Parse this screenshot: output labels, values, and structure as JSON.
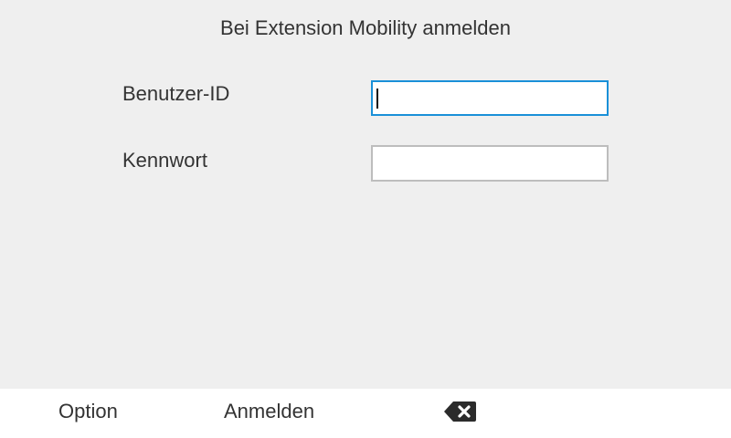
{
  "header": {
    "title": "Bei Extension Mobility anmelden"
  },
  "form": {
    "user_id": {
      "label": "Benutzer-ID",
      "value": "",
      "focused": true
    },
    "password": {
      "label": "Kennwort",
      "value": ""
    }
  },
  "softkeys": {
    "option_label": "Option",
    "login_label": "Anmelden",
    "backspace_icon": "backspace-icon"
  },
  "colors": {
    "background": "#efefef",
    "focus_border": "#1a90d8",
    "softkey_bar": "#ffffff",
    "text": "#333333"
  }
}
